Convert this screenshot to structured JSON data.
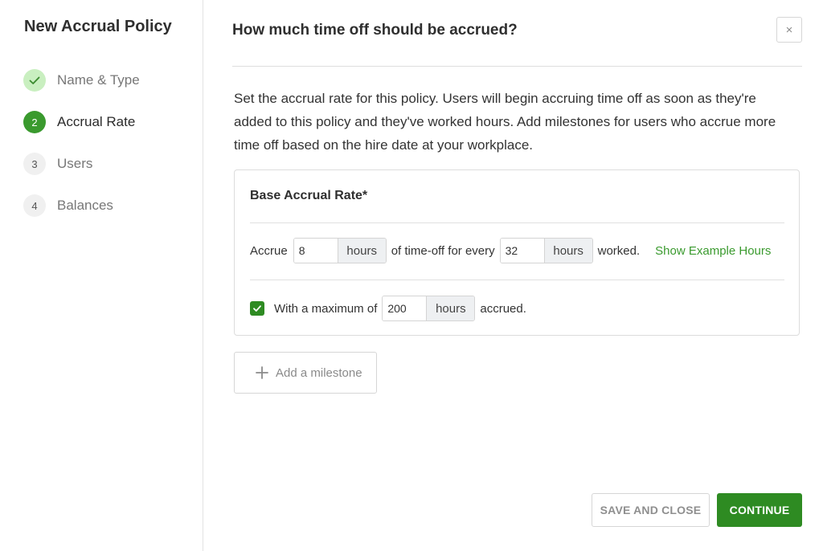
{
  "sidebar": {
    "title": "New Accrual Policy",
    "steps": [
      {
        "number": "",
        "label": "Name & Type",
        "state": "done"
      },
      {
        "number": "2",
        "label": "Accrual Rate",
        "state": "active"
      },
      {
        "number": "3",
        "label": "Users",
        "state": "todo"
      },
      {
        "number": "4",
        "label": "Balances",
        "state": "todo"
      }
    ]
  },
  "main": {
    "heading": "How much time off should be accrued?",
    "close_label": "×",
    "intro": "Set the accrual rate for this policy. Users will begin accruing time off as soon as they're added to this policy and they've worked hours. Add milestones for users who accrue more time off based on the hire date at your workplace."
  },
  "card": {
    "title": "Base Accrual Rate*",
    "row1": {
      "prefix": "Accrue",
      "amount_value": "8",
      "amount_unit": "hours",
      "middle": "of time-off for every",
      "period_value": "32",
      "period_unit": "hours",
      "suffix": "worked.",
      "example_link": "Show Example Hours"
    },
    "row2": {
      "checked": true,
      "prefix": "With a maximum of",
      "max_value": "200",
      "max_unit": "hours",
      "suffix": "accrued."
    }
  },
  "milestone": {
    "label": "Add a milestone"
  },
  "footer": {
    "save_label": "SAVE AND CLOSE",
    "continue_label": "CONTINUE"
  },
  "colors": {
    "accent": "#2e8b22",
    "active_step": "#3a9a2e",
    "done_step": "#c9efc0"
  }
}
